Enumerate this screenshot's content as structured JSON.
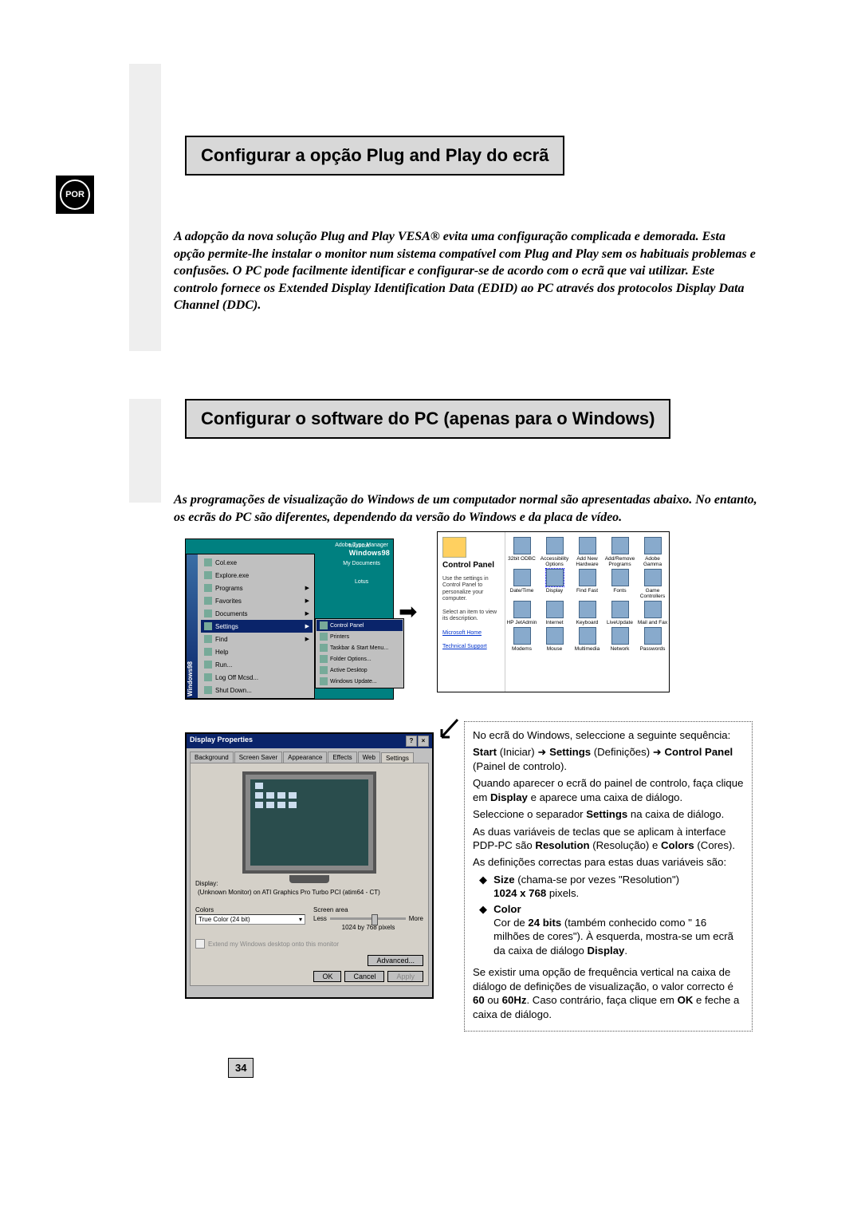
{
  "lang_badge": "POR",
  "heading1": "Configurar a opção Plug and Play do ecrã",
  "intro1": "A adopção da nova solução Plug and Play VESA® evita uma configuração complicada e demorada. Esta opção permite-lhe instalar o monitor num sistema compatível com Plug and Play sem os habituais problemas e confusões. O PC pode facilmente identificar e configurar-se de acordo com o ecrã que vai utilizar. Este controlo fornece os Extended Display Identification Data (EDID) ao PC através dos protocolos Display Data Channel (DDC).",
  "heading2": "Configurar o software do PC (apenas para o Windows)",
  "intro2": "As programações de visualização do Windows de um computador normal são apresentadas abaixo. No entanto, os ecrãs do PC são diferentes, dependendo da versão do Windows e da placa de vídeo.",
  "win_desktop": {
    "brand_small": "Microsoft",
    "brand": "Windows98",
    "stripe": "Windows98",
    "desktop_icons": [
      "Adobe Type Manager",
      "My Documents",
      "Lotus"
    ],
    "start_items": [
      "Col.exe",
      "Explore.exe",
      "Programs",
      "Favorites",
      "Documents",
      "Settings",
      "Find",
      "Help",
      "Run...",
      "Log Off Mcsd...",
      "Shut Down..."
    ],
    "highlight_index": 5,
    "submenu_items": [
      "Control Panel",
      "Printers",
      "Taskbar & Start Menu...",
      "Folder Options...",
      "Active Desktop",
      "Windows Update..."
    ],
    "submenu_highlight_index": 0
  },
  "control_panel": {
    "title": "Control Panel",
    "desc": "Use the settings in Control Panel to personalize your computer.",
    "desc2": "Select an item to view its description.",
    "links": [
      "Microsoft Home",
      "Technical Support"
    ],
    "icons": [
      "32bit ODBC",
      "Accessibility Options",
      "Add New Hardware",
      "Add/Remove Programs",
      "Adobe Gamma",
      "Date/Time",
      "Display",
      "Find Fast",
      "Fonts",
      "Game Controllers",
      "HP JetAdmin",
      "Internet",
      "Keyboard",
      "LiveUpdate",
      "Mail and Fax",
      "Modems",
      "Mouse",
      "Multimedia",
      "Network",
      "Passwords"
    ],
    "selected": "Display"
  },
  "display_props": {
    "title": "Display Properties",
    "tabs": [
      "Background",
      "Screen Saver",
      "Appearance",
      "Effects",
      "Web",
      "Settings"
    ],
    "active_tab": "Settings",
    "display_label": "Display:",
    "display_value": "(Unknown Monitor) on ATI Graphics Pro Turbo PCI (atim64 - CT)",
    "colors_label": "Colors",
    "colors_value": "True Color (24 bit)",
    "screen_area_label": "Screen area",
    "less": "Less",
    "more": "More",
    "screen_area_value": "1024 by 768 pixels",
    "extend_chk": "Extend my Windows desktop onto this monitor",
    "advanced": "Advanced...",
    "ok": "OK",
    "cancel": "Cancel",
    "apply": "Apply"
  },
  "instructions": {
    "line1_a": "No ecrã do Windows, seleccione a seguinte sequência:",
    "line2_pre": "Start",
    "line2_a": " (Iniciar) ➜ ",
    "line2_b": "Settings",
    "line2_c": " (Definições) ➜ ",
    "line2_d": "Control Panel",
    "line2_e": " (Painel de controlo).",
    "line3": "Quando aparecer o ecrã do painel de controlo, faça clique em ",
    "line3_b": "Display",
    "line3_c": " e aparece uma caixa de diálogo.",
    "line4_a": "Seleccione o separador ",
    "line4_b": "Settings",
    "line4_c": " na caixa de diálogo.",
    "line5_a": "As duas variáveis de teclas que se aplicam à interface PDP-PC são ",
    "line5_b": "Resolution",
    "line5_c": " (Resolução) e ",
    "line5_d": "Colors",
    "line5_e": " (Cores).",
    "line6": "As definições correctas para estas duas variáveis são:",
    "bullet1_a": "Size",
    "bullet1_b": " (chama-se por vezes \"Resolution\")",
    "bullet1_c": "1024 x 768",
    "bullet1_d": " pixels.",
    "bullet2_a": "Color",
    "bullet2_b": "Cor de ",
    "bullet2_c": "24 bits",
    "bullet2_d": " (também conhecido como \" 16 milhões de cores\"). À esquerda, mostra-se um ecrã da caixa de diálogo ",
    "bullet2_e": "Display",
    "bullet2_f": ".",
    "line7_a": "Se existir uma opção de frequência vertical na caixa de diálogo de definições de visualização, o valor correcto é ",
    "line7_b": "60",
    "line7_c": " ou ",
    "line7_d": "60Hz",
    "line7_e": ". Caso contrário, faça clique em ",
    "line7_f": "OK",
    "line7_g": " e feche a caixa de diálogo."
  },
  "page_number": "34"
}
